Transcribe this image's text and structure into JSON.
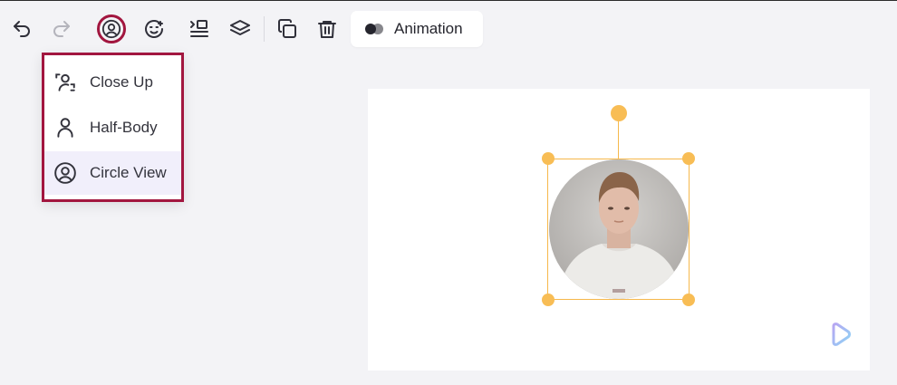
{
  "toolbar": {
    "undo_icon": "undo-icon",
    "redo_icon": "redo-icon",
    "avatar_layout_icon": "user-circle-icon",
    "face_icon": "face-icon",
    "align_icon": "align-left-icon",
    "layers_icon": "layers-icon",
    "duplicate_icon": "duplicate-icon",
    "delete_icon": "trash-icon",
    "animation_label": "Animation",
    "active_color": "#a2163f"
  },
  "layout_menu": {
    "items": [
      {
        "label": "Close Up",
        "icon": "close-up-icon",
        "selected": false
      },
      {
        "label": "Half-Body",
        "icon": "person-icon",
        "selected": false
      },
      {
        "label": "Circle View",
        "icon": "user-circle-icon",
        "selected": true
      }
    ]
  },
  "canvas": {
    "avatar_shape": "circle",
    "selection_color": "#f6b84b",
    "watermark_icon": "brand-logo-icon"
  }
}
